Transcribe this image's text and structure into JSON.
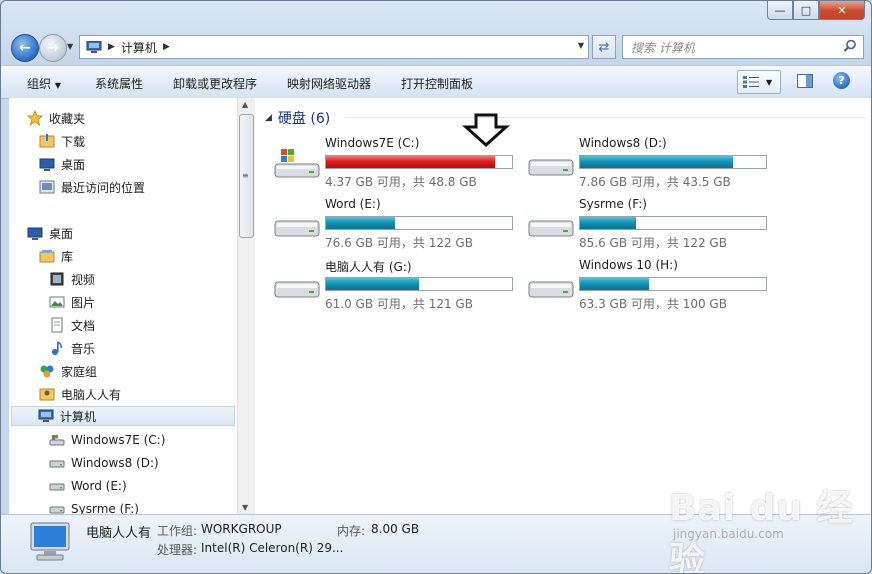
{
  "window": {
    "caption_buttons": [
      "—",
      "□",
      "✕"
    ]
  },
  "nav": {
    "breadcrumb": "计算机",
    "search_placeholder": "搜索 计算机"
  },
  "toolbar": {
    "items": [
      "组织",
      "系统属性",
      "卸载或更改程序",
      "映射网络驱动器",
      "打开控制面板"
    ],
    "help_label": "?"
  },
  "sidebar": {
    "items": [
      {
        "label": "收藏夹",
        "icon": "star-icon"
      },
      {
        "label": "下载",
        "icon": "downloads-folder-icon"
      },
      {
        "label": "桌面",
        "icon": "desktop-icon"
      },
      {
        "label": "最近访问的位置",
        "icon": "recent-places-icon"
      },
      {
        "label": "桌面",
        "icon": "desktop-icon"
      },
      {
        "label": "库",
        "icon": "libraries-icon"
      },
      {
        "label": "视频",
        "icon": "video-library-icon"
      },
      {
        "label": "图片",
        "icon": "pictures-library-icon"
      },
      {
        "label": "文档",
        "icon": "documents-library-icon"
      },
      {
        "label": "音乐",
        "icon": "music-library-icon"
      },
      {
        "label": "家庭组",
        "icon": "homegroup-icon"
      },
      {
        "label": "电脑人人有",
        "icon": "user-folder-icon"
      },
      {
        "label": "计算机",
        "icon": "computer-icon"
      },
      {
        "label": "Windows7E (C:)",
        "icon": "system-drive-icon"
      },
      {
        "label": "Windows8 (D:)",
        "icon": "drive-icon"
      },
      {
        "label": "Word (E:)",
        "icon": "drive-icon"
      },
      {
        "label": "Sysrme (F:)",
        "icon": "drive-icon"
      }
    ]
  },
  "content": {
    "group_title": "硬盘 (6)",
    "drives": [
      {
        "name": "Windows7E (C:)",
        "size_text": "4.37 GB 可用，共 48.8 GB",
        "used_fraction": 0.91,
        "nearly_full": true,
        "icon": "system-drive-icon"
      },
      {
        "name": "Windows8 (D:)",
        "size_text": "7.86 GB 可用，共 43.5 GB",
        "used_fraction": 0.82,
        "nearly_full": false,
        "icon": "drive-icon"
      },
      {
        "name": "Word (E:)",
        "size_text": "76.6 GB 可用，共 122 GB",
        "used_fraction": 0.37,
        "nearly_full": false,
        "icon": "drive-icon"
      },
      {
        "name": "Sysrme (F:)",
        "size_text": "85.6 GB 可用，共 122 GB",
        "used_fraction": 0.3,
        "nearly_full": false,
        "icon": "drive-icon"
      },
      {
        "name": "电脑人人有 (G:)",
        "size_text": "61.0 GB 可用，共 121 GB",
        "used_fraction": 0.5,
        "nearly_full": false,
        "icon": "drive-icon"
      },
      {
        "name": "Windows 10 (H:)",
        "size_text": "63.3 GB 可用，共 100 GB",
        "used_fraction": 0.37,
        "nearly_full": false,
        "icon": "drive-icon"
      }
    ],
    "annotation": "down-arrow-icon"
  },
  "details": {
    "name": "电脑人人有",
    "workgroup_label": "工作组:",
    "workgroup_value": "WORKGROUP",
    "memory_label": "内存:",
    "memory_value": "8.00 GB",
    "cpu_label": "处理器:",
    "cpu_value": "Intel(R) Celeron(R) 29..."
  },
  "watermark": {
    "text": "Bai du 经验",
    "url": "jingyan.baidu.com"
  },
  "colors": {
    "bar_normal": "#1593b6",
    "bar_full": "#dc1f1f",
    "group_title": "#1e3287"
  }
}
